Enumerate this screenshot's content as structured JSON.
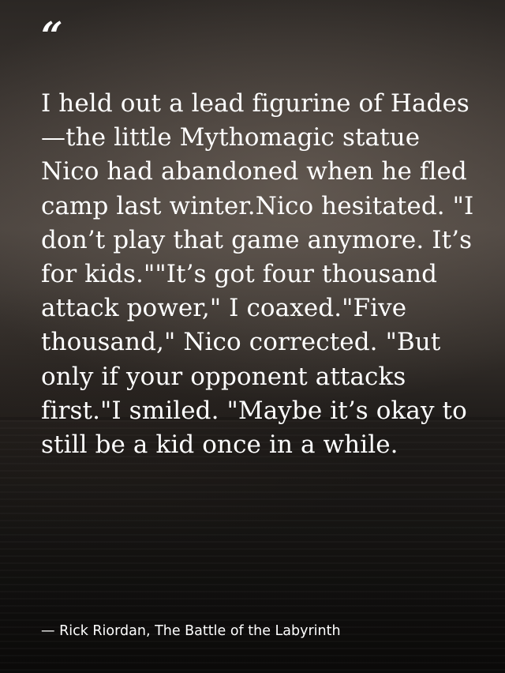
{
  "quote": {
    "mark": "“",
    "text": "I held out a lead figurine of Hades—the little Mythomagic statue Nico had abandoned when he fled camp last winter.Nico hesitated. \"I don’t play that game anymore. It’s for kids.\"\"It’s got four thousand attack power,\" I coaxed.\"Five thousand,\" Nico corrected. \"But only if your opponent attacks first.\"I smiled. \"Maybe it’s okay to still be a kid once in a while.",
    "attribution": "— Rick Riordan, The Battle of the Labyrinth"
  },
  "colors": {
    "text": "#ffffff",
    "background_top": "#2b2724",
    "background_bottom": "#100f0e"
  }
}
